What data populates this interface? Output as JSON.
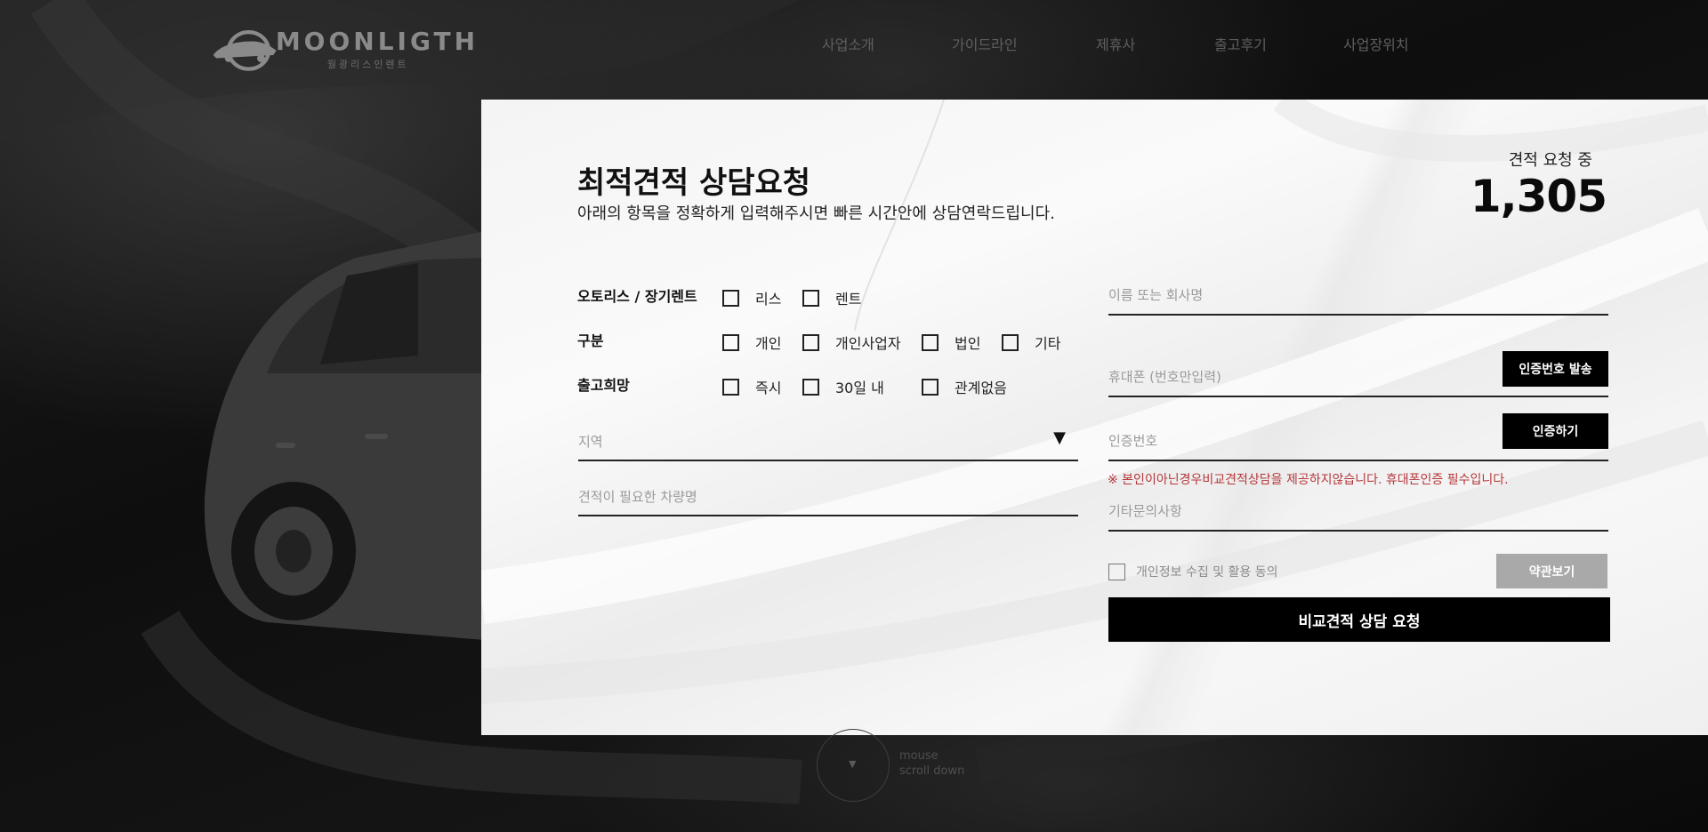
{
  "header": {
    "logo": {
      "name": "MOONLIGTH",
      "sub": "월광리스인렌트"
    },
    "nav": [
      "사업소개",
      "가이드라인",
      "제휴사",
      "출고후기",
      "사업장위치"
    ]
  },
  "form": {
    "title": "최적견적 상담요청",
    "subtitle": "아래의 항목을 정확하게 입력해주시면 빠른 시간안에 상담연락드립니다.",
    "counter_label": "견적 요청 중",
    "counter_value": "1,305",
    "rows": [
      {
        "label": "오토리스 / 장기렌트",
        "options": [
          "리스",
          "렌트"
        ]
      },
      {
        "label": "구분",
        "options": [
          "개인",
          "개인사업자",
          "법인",
          "기타"
        ]
      },
      {
        "label": "출고희망",
        "options": [
          "즉시",
          "30일 내",
          "관계없음"
        ]
      }
    ],
    "region_placeholder": "지역",
    "car_placeholder": "견적이 필요한 차량명",
    "name_placeholder": "이름 또는 회사명",
    "phone_placeholder": "휴대폰 (번호만입력)",
    "send_code_label": "인증번호 발송",
    "code_placeholder": "인증번호",
    "verify_label": "인증하기",
    "warning": "※ 본인이아닌경우비교견적상담을 제공하지않습니다. 휴대폰인증 필수입니다.",
    "etc_placeholder": "기타문의사항",
    "agree_label": "개인정보 수집 및 활용 동의",
    "terms_label": "약관보기",
    "submit_label": "비교견적 상담 요청"
  },
  "scroll_hint": {
    "line1": "mouse",
    "line2": "scroll down"
  }
}
